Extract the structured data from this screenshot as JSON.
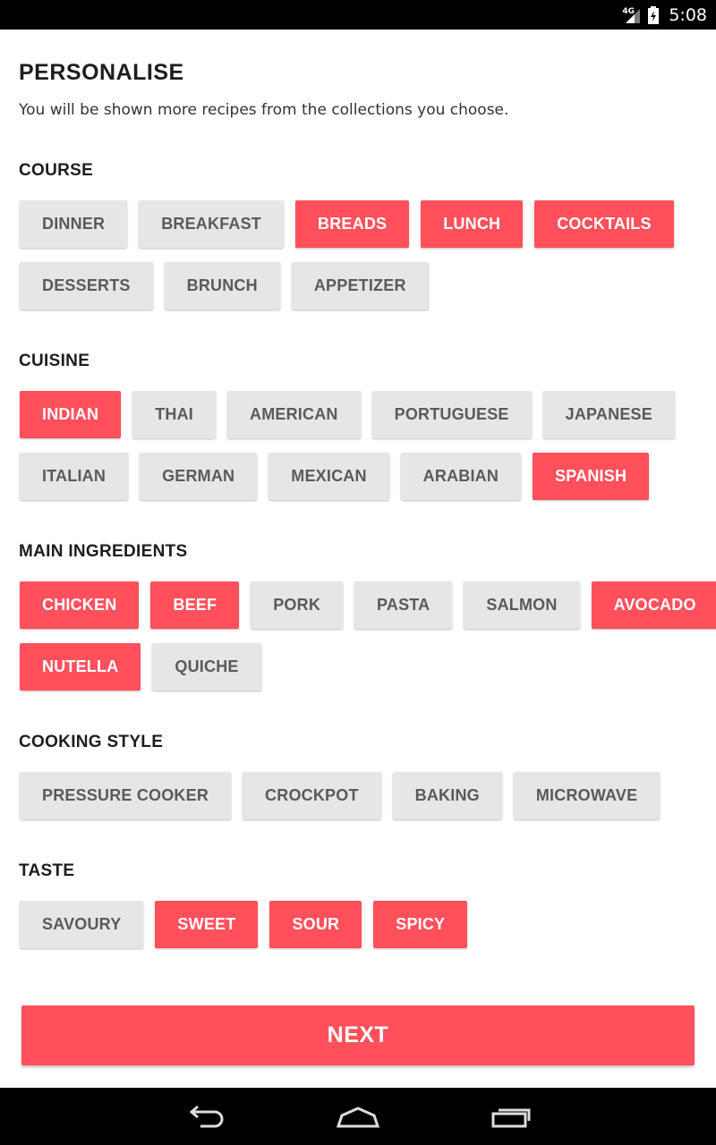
{
  "status_bar": {
    "network": "4G",
    "time": "5:08",
    "icons": [
      "signal-icon",
      "battery-icon"
    ]
  },
  "page": {
    "title": "PERSONALISE",
    "subtitle": "You will be shown more recipes from the collections you choose."
  },
  "colors": {
    "accent": "#ff505b",
    "chip_unselected": "#e6e6e6",
    "chip_text": "#5a5a5a"
  },
  "sections": [
    {
      "title": "COURSE",
      "rows": [
        [
          {
            "label": "DINNER",
            "selected": false
          },
          {
            "label": "BREAKFAST",
            "selected": false
          },
          {
            "label": "BREADS",
            "selected": true
          },
          {
            "label": "LUNCH",
            "selected": true
          },
          {
            "label": "COCKTAILS",
            "selected": true
          }
        ],
        [
          {
            "label": "DESSERTS",
            "selected": false
          },
          {
            "label": "BRUNCH",
            "selected": false
          },
          {
            "label": "APPETIZER",
            "selected": false
          }
        ]
      ]
    },
    {
      "title": "CUISINE",
      "rows": [
        [
          {
            "label": "INDIAN",
            "selected": true
          },
          {
            "label": "THAI",
            "selected": false
          },
          {
            "label": "AMERICAN",
            "selected": false
          },
          {
            "label": "PORTUGUESE",
            "selected": false
          },
          {
            "label": "JAPANESE",
            "selected": false
          }
        ],
        [
          {
            "label": "ITALIAN",
            "selected": false
          },
          {
            "label": "GERMAN",
            "selected": false
          },
          {
            "label": "MEXICAN",
            "selected": false
          },
          {
            "label": "ARABIAN",
            "selected": false
          },
          {
            "label": "SPANISH",
            "selected": true
          }
        ]
      ]
    },
    {
      "title": "MAIN INGREDIENTS",
      "rows": [
        [
          {
            "label": "CHICKEN",
            "selected": true
          },
          {
            "label": "BEEF",
            "selected": true
          },
          {
            "label": "PORK",
            "selected": false
          },
          {
            "label": "PASTA",
            "selected": false
          },
          {
            "label": "SALMON",
            "selected": false
          },
          {
            "label": "AVOCADO",
            "selected": true
          }
        ],
        [
          {
            "label": "NUTELLA",
            "selected": true
          },
          {
            "label": "QUICHE",
            "selected": false
          }
        ]
      ]
    },
    {
      "title": "COOKING STYLE",
      "rows": [
        [
          {
            "label": "PRESSURE COOKER",
            "selected": false
          },
          {
            "label": "CROCKPOT",
            "selected": false
          },
          {
            "label": "BAKING",
            "selected": false
          },
          {
            "label": "MICROWAVE",
            "selected": false
          }
        ]
      ]
    },
    {
      "title": "TASTE",
      "rows": [
        [
          {
            "label": "SAVOURY",
            "selected": false
          },
          {
            "label": "SWEET",
            "selected": true
          },
          {
            "label": "SOUR",
            "selected": true
          },
          {
            "label": "SPICY",
            "selected": true
          }
        ]
      ]
    }
  ],
  "next_button": {
    "label": "NEXT"
  },
  "nav_bar": {
    "buttons": [
      "back-icon",
      "home-icon",
      "recent-apps-icon"
    ]
  }
}
